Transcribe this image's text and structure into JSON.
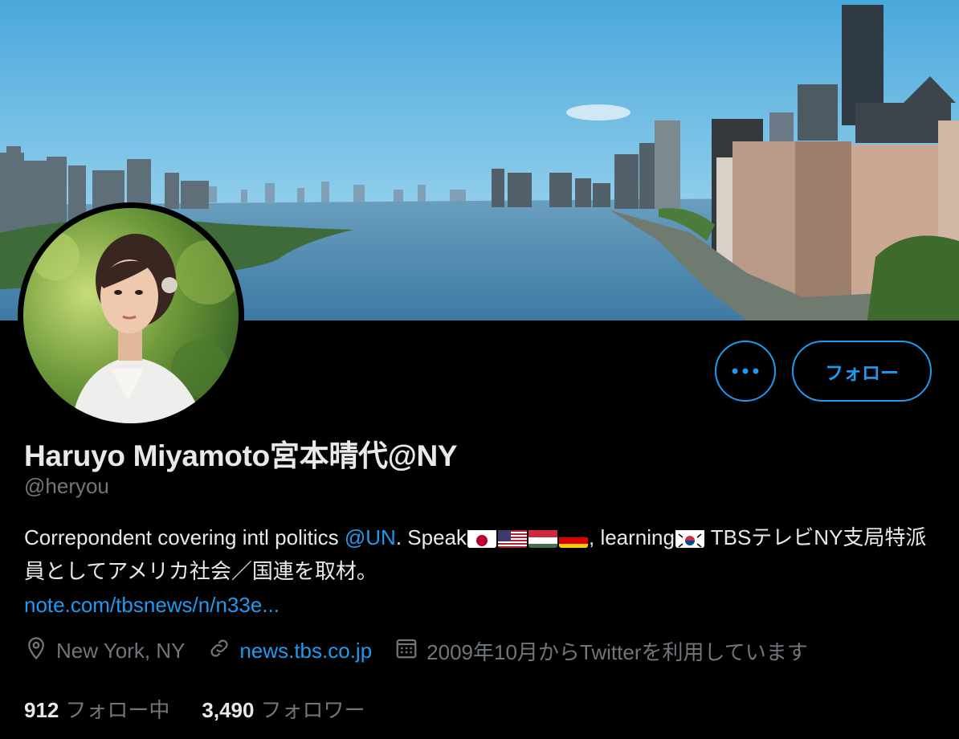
{
  "profile": {
    "display_name": "Haruyo Miyamoto宮本晴代@NY",
    "handle": "@heryou",
    "bio": {
      "text1": "Correpondent covering intl politics ",
      "mention": "@UN",
      "text2": ". Speak",
      "flags_speak": [
        "flag-japan-icon",
        "flag-usa-icon",
        "flag-hungary-icon",
        "flag-germany-icon"
      ],
      "text3": ", learning",
      "flags_learning": [
        "flag-korea-icon"
      ],
      "text4": " TBSテレビNY支局特派員としてアメリカ社会／国連を取材。",
      "link": "note.com/tbsnews/n/n33e..."
    },
    "location": "New York, NY",
    "website": "news.tbs.co.jp",
    "joined": "2009年10月からTwitterを利用しています",
    "following_count": "912",
    "following_label": "フォロー中",
    "followers_count": "3,490",
    "followers_label": "フォロワー"
  },
  "actions": {
    "more_icon": "more-horizontal-icon",
    "follow_label": "フォロー"
  },
  "colors": {
    "accent": "#1d9bf0",
    "background": "#000000",
    "secondary_text": "#71767b",
    "primary_text": "#e7e9ea"
  }
}
